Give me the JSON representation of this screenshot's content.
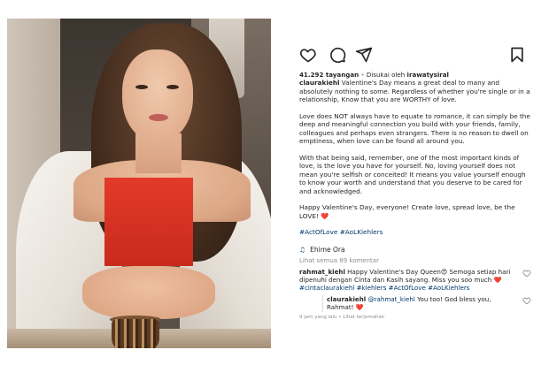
{
  "post": {
    "views": "41.292 tayangan",
    "liked_by_prefix": "Disukai oleh",
    "liked_by_user": "irawatysiral",
    "author": "claurakiehl",
    "caption_first": "Valentine's Day means a great deal to many and absolutely nothing to some. Regardless of whether you're single or in a relationship, Know that you are WORTHY of love.",
    "caption_p2": "Love does NOT always have to equate to romance, it can simply be the deep and meaningful connection you build with your friends, family, colleagues and perhaps even strangers. There is no reason to dwell on emptiness, when love can be found all around you.",
    "caption_p3": "With that being said, remember, one of the most important kinds of love, is the love you have for yourself. No, loving yourself does not mean you're selfish or conceited! It means you value yourself enough to know your worth and understand that you deserve to be cared for and acknowledged.",
    "caption_p4": "Happy Valentine's Day, everyone! Create love, spread love, be the LOVE!",
    "caption_p4_emoji": "❤️",
    "hashtags": "#ActOfLove #AoLKiehlers",
    "music_icon": "music-note-icon",
    "music": "Ehime Ora",
    "see_all_comments": "Lihat semua 89 komentar"
  },
  "comments": [
    {
      "user": "rahmat_kiehl",
      "text": "Happy Valentine's Day Queen😍 Semoga setiap hari dipenuhi dengan Cinta dan Kasih sayang. Miss you soo much",
      "emoji": "❤️",
      "hashtags": "#cintaclaurakiehl #kiehlers #ActOfLove #AoLKiehlers"
    }
  ],
  "reply": {
    "user": "claurakiehl",
    "mention": "@rahmat_kiehl",
    "text": "You too! God bless you, Rahmat!",
    "emoji": "❤️",
    "time": "9 jam yang lalu",
    "see_translation": "Lihat terjemahan"
  },
  "icons": {
    "like": "heart-outline-icon",
    "comment": "comment-bubble-icon",
    "share": "paper-plane-icon",
    "save": "bookmark-icon"
  },
  "colors": {
    "link": "#00376b",
    "heart": "#ed4956",
    "muted": "#8e8e8e",
    "text": "#262626"
  }
}
